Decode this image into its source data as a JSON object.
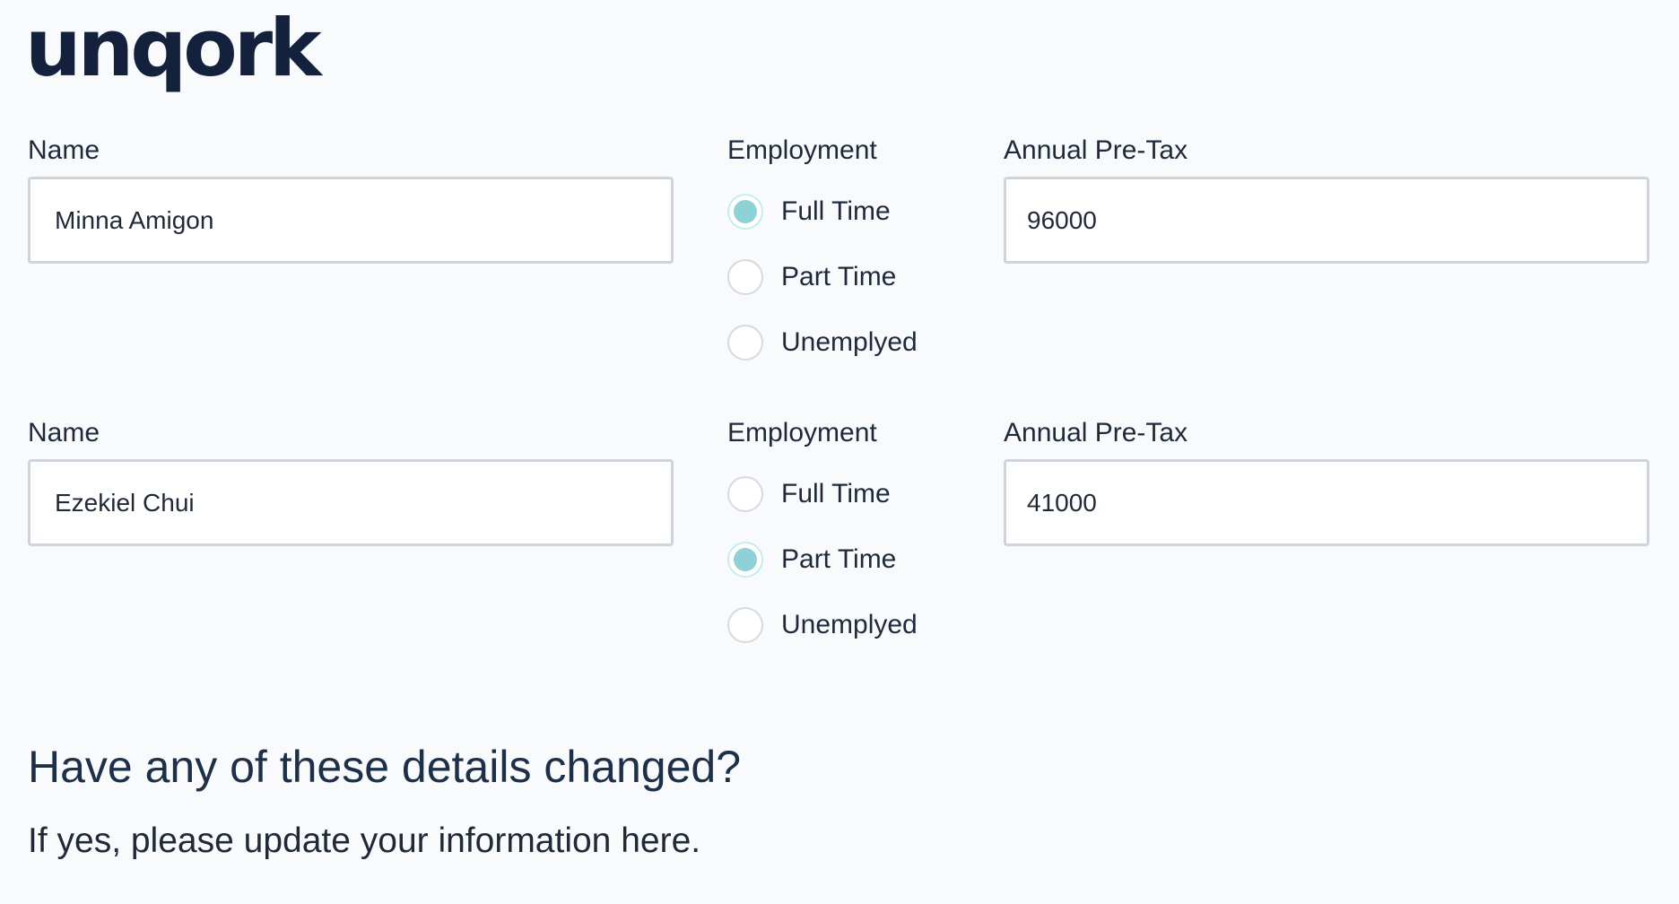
{
  "brand": {
    "logo_text": "unqork",
    "logo_color": "#14213d"
  },
  "form": {
    "rows": [
      {
        "name_label": "Name",
        "name_value": "Minna Amigon",
        "employment_label": "Employment",
        "employment_options": [
          "Full Time",
          "Part Time",
          "Unemplyed"
        ],
        "employment_selected": "Full Time",
        "tax_label": "Annual Pre-Tax",
        "tax_value": "96000"
      },
      {
        "name_label": "Name",
        "name_value": "Ezekiel Chui",
        "employment_label": "Employment",
        "employment_options": [
          "Full Time",
          "Part Time",
          "Unemplyed"
        ],
        "employment_selected": "Part Time",
        "tax_label": "Annual Pre-Tax",
        "tax_value": "41000"
      }
    ]
  },
  "prompt": {
    "heading": "Have any of these details changed?",
    "subtext": "If yes, please update your information here."
  },
  "colors": {
    "background": "#f8fafc",
    "radio_selected": "#8ed1d6",
    "input_border": "#cfd4da",
    "text": "#1e293b"
  }
}
